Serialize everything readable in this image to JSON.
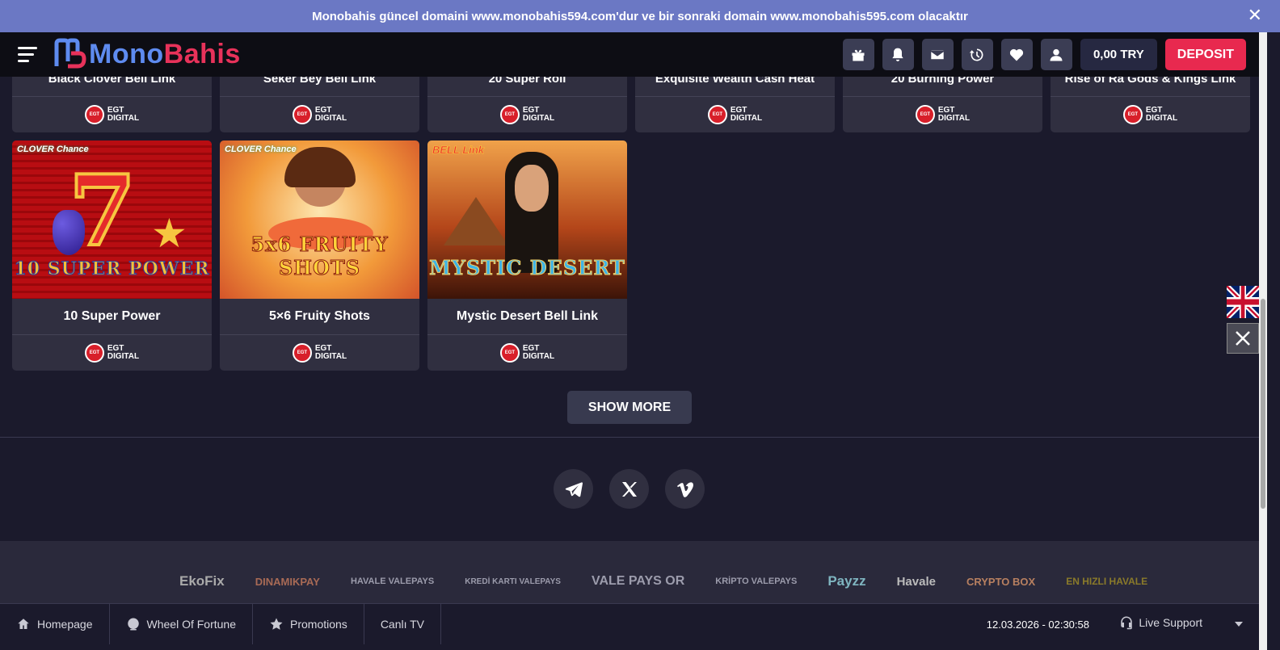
{
  "announcement": {
    "text": "Monobahis güncel domaini www.monobahis594.com'dur ve bir sonraki domain www.monobahis595.com olacaktır",
    "close": "✕"
  },
  "header": {
    "logo_mono": "Mono",
    "logo_bahis": "Bahis",
    "balance": "0,00 TRY",
    "deposit_label": "DEPOSIT"
  },
  "provider": {
    "line1": "EGT",
    "line2": "DIGITAL",
    "badge": "EGT"
  },
  "games_row1": [
    {
      "title": "Black Clover Bell Link"
    },
    {
      "title": "Seker Bey Bell Link"
    },
    {
      "title": "20 Super Roll"
    },
    {
      "title": "Exquisite Wealth Cash Heat"
    },
    {
      "title": "20 Burning Power"
    },
    {
      "title": "Rise of Ra Gods & Kings Link"
    }
  ],
  "games_row2": [
    {
      "title": "10 Super Power",
      "art_label": "10 SUPER POWER",
      "badge": "CLOVER Chance"
    },
    {
      "title": "5×6 Fruity Shots",
      "art_label": "5x6 FRUITY SHOTS",
      "badge": "CLOVER Chance"
    },
    {
      "title": "Mystic Desert Bell Link",
      "art_label": "MYSTIC DESERT",
      "badge": "BELL Link"
    }
  ],
  "show_more": "SHOW MORE",
  "payments": [
    "EkoFix",
    "DINAMIKPAY",
    "HAVALE VALEPAYS",
    "KREDİ KARTI VALEPAYS",
    "VALE PAYS OR",
    "KRİPTO VALEPAYS",
    "Payzz",
    "Havale",
    "CRYPTO BOX",
    "EN HIZLI HAVALE"
  ],
  "bottom_nav": [
    {
      "label": "Homepage"
    },
    {
      "label": "Wheel Of Fortune"
    },
    {
      "label": "Promotions"
    },
    {
      "label": "Canlı TV"
    }
  ],
  "datetime": "12.03.2026 - 02:30:58",
  "support_label": "Live Support"
}
